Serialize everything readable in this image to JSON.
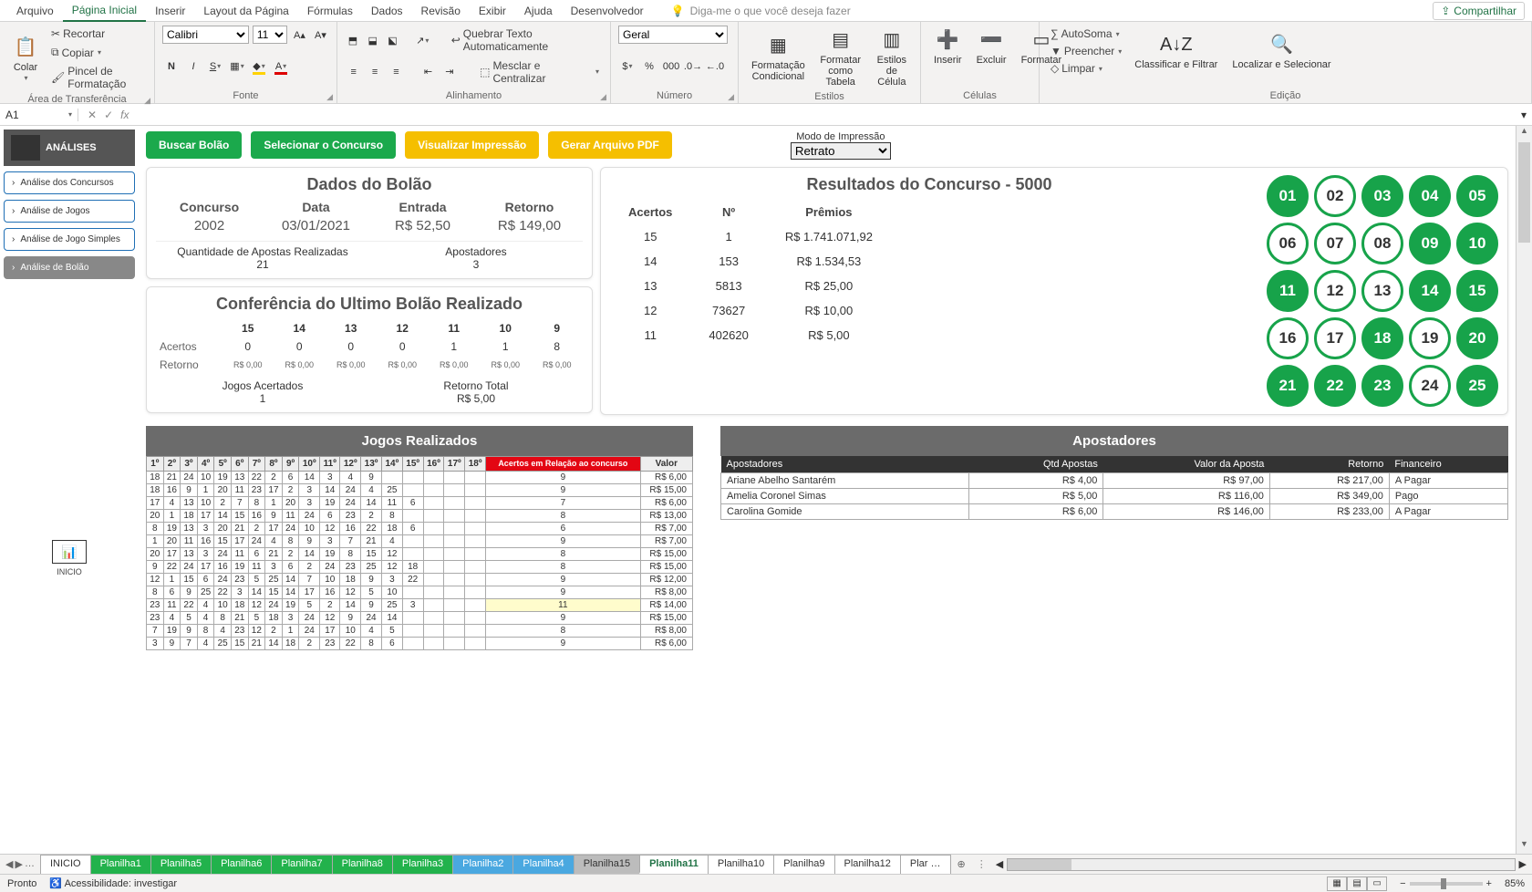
{
  "menu": {
    "tabs": [
      "Arquivo",
      "Página Inicial",
      "Inserir",
      "Layout da Página",
      "Fórmulas",
      "Dados",
      "Revisão",
      "Exibir",
      "Ajuda",
      "Desenvolvedor"
    ],
    "active": 1,
    "tellme_placeholder": "Diga-me o que você deseja fazer",
    "share": "Compartilhar"
  },
  "ribbon": {
    "clipboard": {
      "paste": "Colar",
      "cut": "Recortar",
      "copy": "Copiar",
      "painter": "Pincel de Formatação",
      "label": "Área de Transferência"
    },
    "font": {
      "name": "Calibri",
      "size": "11",
      "label": "Fonte"
    },
    "align": {
      "wrap": "Quebrar Texto Automaticamente",
      "merge": "Mesclar e Centralizar",
      "label": "Alinhamento"
    },
    "number": {
      "format": "Geral",
      "label": "Número"
    },
    "styles": {
      "cond": "Formatação Condicional",
      "table": "Formatar como Tabela",
      "cell": "Estilos de Célula",
      "label": "Estilos"
    },
    "cells": {
      "insert": "Inserir",
      "delete": "Excluir",
      "format": "Formatar",
      "label": "Células"
    },
    "editing": {
      "sum": "AutoSoma",
      "fill": "Preencher",
      "clear": "Limpar",
      "sort": "Classificar e Filtrar",
      "find": "Localizar e Selecionar",
      "label": "Edição"
    }
  },
  "fx": {
    "cell": "A1",
    "formula": ""
  },
  "side": {
    "title": "ANÁLISES",
    "items": [
      "Análise dos Concursos",
      "Análise de Jogos",
      "Análise de Jogo Simples",
      "Análise de Bolão"
    ],
    "active": 3,
    "inicio": "INICIO"
  },
  "actions": {
    "buscar": "Buscar Bolão",
    "selecionar": "Selecionar o Concurso",
    "visualizar": "Visualizar Impressão",
    "gerar": "Gerar Arquivo PDF",
    "printmode_lbl": "Modo de Impressão",
    "printmode_val": "Retrato"
  },
  "bolao": {
    "title": "Dados do Bolão",
    "concurso_h": "Concurso",
    "concurso_v": "2002",
    "data_h": "Data",
    "data_v": "03/01/2021",
    "entrada_h": "Entrada",
    "entrada_v": "R$ 52,50",
    "retorno_h": "Retorno",
    "retorno_v": "R$ 149,00",
    "qtd_h": "Quantidade de Apostas Realizadas",
    "qtd_v": "21",
    "apo_h": "Apostadores",
    "apo_v": "3"
  },
  "conf": {
    "title": "Conferência do Ultimo Bolão Realizado",
    "cols": [
      "15",
      "14",
      "13",
      "12",
      "11",
      "10",
      "9"
    ],
    "acertos_lbl": "Acertos",
    "acertos": [
      "0",
      "0",
      "0",
      "0",
      "1",
      "1",
      "8"
    ],
    "retorno_lbl": "Retorno",
    "retorno": [
      "R$ 0,00",
      "R$ 0,00",
      "R$ 0,00",
      "R$ 0,00",
      "R$ 0,00",
      "R$ 0,00",
      "R$ 0,00"
    ],
    "jg_h": "Jogos Acertados",
    "jg_v": "1",
    "rt_h": "Retorno Total",
    "rt_v": "R$ 5,00"
  },
  "result": {
    "title": "Resultados do Concurso - 5000",
    "head": [
      "Acertos",
      "Nº",
      "Prêmios"
    ],
    "rows": [
      [
        "15",
        "1",
        "R$ 1.741.071,92"
      ],
      [
        "14",
        "153",
        "R$ 1.534,53"
      ],
      [
        "13",
        "5813",
        "R$ 25,00"
      ],
      [
        "12",
        "73627",
        "R$ 10,00"
      ],
      [
        "11",
        "402620",
        "R$ 5,00"
      ]
    ],
    "balls": [
      {
        "n": "01",
        "on": true
      },
      {
        "n": "02",
        "on": false
      },
      {
        "n": "03",
        "on": true
      },
      {
        "n": "04",
        "on": true
      },
      {
        "n": "05",
        "on": true
      },
      {
        "n": "06",
        "on": false
      },
      {
        "n": "07",
        "on": false
      },
      {
        "n": "08",
        "on": false
      },
      {
        "n": "09",
        "on": true
      },
      {
        "n": "10",
        "on": true
      },
      {
        "n": "11",
        "on": true
      },
      {
        "n": "12",
        "on": false
      },
      {
        "n": "13",
        "on": false
      },
      {
        "n": "14",
        "on": true
      },
      {
        "n": "15",
        "on": true
      },
      {
        "n": "16",
        "on": false
      },
      {
        "n": "17",
        "on": false
      },
      {
        "n": "18",
        "on": true
      },
      {
        "n": "19",
        "on": false
      },
      {
        "n": "20",
        "on": true
      },
      {
        "n": "21",
        "on": true
      },
      {
        "n": "22",
        "on": true
      },
      {
        "n": "23",
        "on": true
      },
      {
        "n": "24",
        "on": false
      },
      {
        "n": "25",
        "on": true
      }
    ]
  },
  "jogos": {
    "title": "Jogos Realizados",
    "heads": [
      "1º",
      "2º",
      "3º",
      "4º",
      "5º",
      "6º",
      "7º",
      "8º",
      "9º",
      "10º",
      "11º",
      "12º",
      "13º",
      "14º",
      "15º",
      "16º",
      "17º",
      "18º"
    ],
    "red": "Acertos em Relação ao concurso",
    "valor": "Valor",
    "rows": [
      {
        "n": [
          "18",
          "21",
          "24",
          "10",
          "19",
          "13",
          "22",
          "2",
          "6",
          "14",
          "3",
          "4",
          "9",
          "",
          "",
          "",
          "",
          ""
        ],
        "a": "9",
        "v": "R$ 6,00"
      },
      {
        "n": [
          "18",
          "16",
          "9",
          "1",
          "20",
          "11",
          "23",
          "17",
          "2",
          "3",
          "14",
          "24",
          "4",
          "25",
          "",
          "",
          "",
          ""
        ],
        "a": "9",
        "v": "R$ 15,00"
      },
      {
        "n": [
          "17",
          "4",
          "13",
          "10",
          "2",
          "7",
          "8",
          "1",
          "20",
          "3",
          "19",
          "24",
          "14",
          "11",
          "6",
          "",
          "",
          ""
        ],
        "a": "7",
        "v": "R$ 6,00"
      },
      {
        "n": [
          "20",
          "1",
          "18",
          "17",
          "14",
          "15",
          "16",
          "9",
          "11",
          "24",
          "6",
          "23",
          "2",
          "8",
          "",
          "",
          "",
          ""
        ],
        "a": "8",
        "v": "R$ 13,00"
      },
      {
        "n": [
          "8",
          "19",
          "13",
          "3",
          "20",
          "21",
          "2",
          "17",
          "24",
          "10",
          "12",
          "16",
          "22",
          "18",
          "6",
          "",
          "",
          ""
        ],
        "a": "6",
        "v": "R$ 7,00"
      },
      {
        "n": [
          "1",
          "20",
          "11",
          "16",
          "15",
          "17",
          "24",
          "4",
          "8",
          "9",
          "3",
          "7",
          "21",
          "4",
          "",
          "",
          "",
          ""
        ],
        "a": "9",
        "v": "R$ 7,00"
      },
      {
        "n": [
          "20",
          "17",
          "13",
          "3",
          "24",
          "11",
          "6",
          "21",
          "2",
          "14",
          "19",
          "8",
          "15",
          "12",
          "",
          "",
          "",
          ""
        ],
        "a": "8",
        "v": "R$ 15,00"
      },
      {
        "n": [
          "9",
          "22",
          "24",
          "17",
          "16",
          "19",
          "11",
          "3",
          "6",
          "2",
          "24",
          "23",
          "25",
          "12",
          "18",
          "",
          "",
          ""
        ],
        "a": "8",
        "v": "R$ 15,00"
      },
      {
        "n": [
          "12",
          "1",
          "15",
          "6",
          "24",
          "23",
          "5",
          "25",
          "14",
          "7",
          "10",
          "18",
          "9",
          "3",
          "22",
          "",
          "",
          ""
        ],
        "a": "9",
        "v": "R$ 12,00"
      },
      {
        "n": [
          "8",
          "6",
          "9",
          "25",
          "22",
          "3",
          "14",
          "15",
          "14",
          "17",
          "16",
          "12",
          "5",
          "10",
          "",
          "",
          "",
          ""
        ],
        "a": "9",
        "v": "R$ 8,00"
      },
      {
        "n": [
          "23",
          "11",
          "22",
          "4",
          "10",
          "18",
          "12",
          "24",
          "19",
          "5",
          "2",
          "14",
          "9",
          "25",
          "3",
          "",
          "",
          ""
        ],
        "a": "11",
        "hl": true,
        "v": "R$ 14,00"
      },
      {
        "n": [
          "23",
          "4",
          "5",
          "4",
          "8",
          "21",
          "5",
          "18",
          "3",
          "24",
          "12",
          "9",
          "24",
          "14",
          "",
          "",
          "",
          ""
        ],
        "a": "9",
        "v": "R$ 15,00"
      },
      {
        "n": [
          "7",
          "19",
          "9",
          "8",
          "4",
          "23",
          "12",
          "2",
          "1",
          "24",
          "17",
          "10",
          "4",
          "5",
          "",
          "",
          "",
          ""
        ],
        "a": "8",
        "v": "R$ 8,00"
      },
      {
        "n": [
          "3",
          "9",
          "7",
          "4",
          "25",
          "15",
          "21",
          "14",
          "18",
          "2",
          "23",
          "22",
          "8",
          "6",
          "",
          "",
          "",
          ""
        ],
        "a": "9",
        "v": "R$ 6,00"
      }
    ]
  },
  "apost": {
    "title": "Apostadores",
    "heads": [
      "Apostadores",
      "Qtd Apostas",
      "Valor da Aposta",
      "Retorno",
      "Financeiro"
    ],
    "rows": [
      [
        "Ariane Abelho Santarém",
        "",
        "R$ 4,00",
        "R$ 97,00",
        "R$ 217,00",
        "A Pagar"
      ],
      [
        "Amelia Coronel Simas",
        "",
        "R$ 5,00",
        "R$ 116,00",
        "R$ 349,00",
        "Pago"
      ],
      [
        "Carolina Gomide",
        "",
        "R$ 6,00",
        "R$ 146,00",
        "R$ 233,00",
        "A Pagar"
      ]
    ]
  },
  "sheets": {
    "tabs": [
      {
        "t": "INICIO",
        "c": ""
      },
      {
        "t": "Planilha1",
        "c": "g"
      },
      {
        "t": "Planilha5",
        "c": "g"
      },
      {
        "t": "Planilha6",
        "c": "g"
      },
      {
        "t": "Planilha7",
        "c": "g"
      },
      {
        "t": "Planilha8",
        "c": "g"
      },
      {
        "t": "Planilha3",
        "c": "g"
      },
      {
        "t": "Planilha2",
        "c": "b"
      },
      {
        "t": "Planilha4",
        "c": "b"
      },
      {
        "t": "Planilha15",
        "c": "gr"
      },
      {
        "t": "Planilha11",
        "c": "active"
      },
      {
        "t": "Planilha10",
        "c": ""
      },
      {
        "t": "Planilha9",
        "c": ""
      },
      {
        "t": "Planilha12",
        "c": ""
      },
      {
        "t": "Plar …",
        "c": ""
      }
    ]
  },
  "status": {
    "ready": "Pronto",
    "acc": "Acessibilidade: investigar",
    "zoom": "85%"
  }
}
